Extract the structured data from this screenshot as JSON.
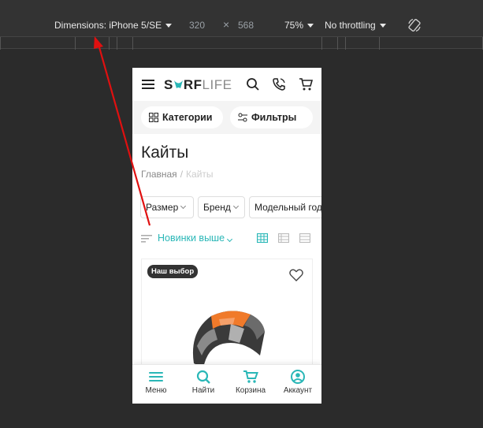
{
  "devtools": {
    "dimensions_label": "Dimensions: iPhone 5/SE",
    "width": "320",
    "times": "×",
    "height": "568",
    "zoom": "75%",
    "throttling": "No throttling",
    "rotate_icon": "rotate-icon"
  },
  "site": {
    "logo_part1": "S",
    "logo_part2": "RF",
    "logo_part3": "LIFE",
    "header_icons": [
      "menu-icon",
      "search-icon",
      "phone-icon",
      "cart-icon"
    ],
    "categories_label": "Категории",
    "filters_label": "Фильтры",
    "page_title": "Кайты",
    "breadcrumb": {
      "home": "Главная",
      "separator": "/",
      "current": "Кайты"
    },
    "filters": [
      "Размер",
      "Бренд",
      "Модельный год"
    ],
    "sort_label": "Новинки выше",
    "product": {
      "badge": "Наш выбор"
    },
    "bottom_nav": [
      {
        "label": "Меню",
        "icon": "menu-icon"
      },
      {
        "label": "Найти",
        "icon": "search-icon"
      },
      {
        "label": "Корзина",
        "icon": "cart-icon"
      },
      {
        "label": "Аккаунт",
        "icon": "account-icon"
      }
    ],
    "accent_color": "#2ab7b7"
  }
}
